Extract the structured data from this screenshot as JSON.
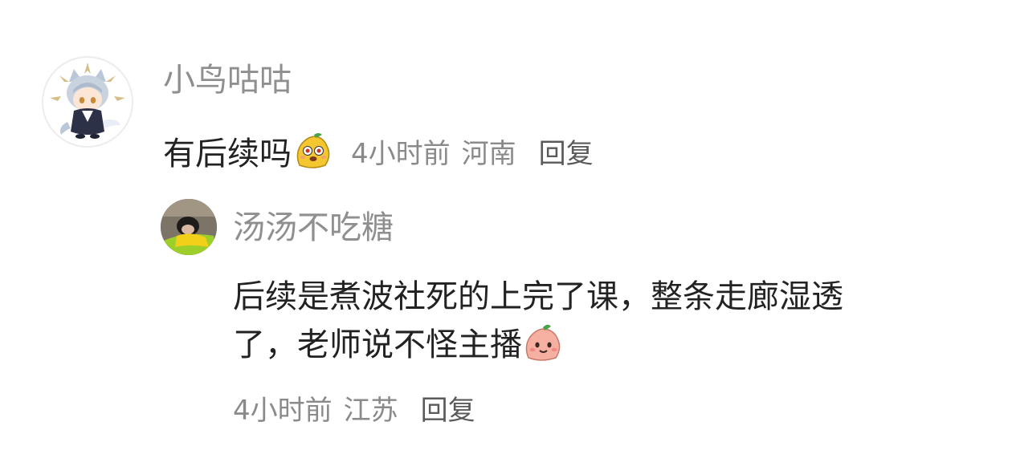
{
  "comment": {
    "username": "小鸟咕咕",
    "text": "有后续吗",
    "time": "4小时前",
    "location": "河南",
    "reply_label": "回复",
    "avatar_icon": "anime-cat-boy-avatar",
    "sticker_icon": "yellow-dumpling-sticker"
  },
  "reply": {
    "username": "汤汤不吃糖",
    "text": "后续是煮波社死的上完了课，整条走廊湿透了，老师说不怪主播",
    "time": "4小时前",
    "location": "江苏",
    "reply_label": "回复",
    "avatar_icon": "photo-avatar",
    "sticker_icon": "pink-dumpling-sticker"
  },
  "colors": {
    "username": "#8f8f8f",
    "text": "#222222",
    "meta": "#8a8a8a"
  }
}
